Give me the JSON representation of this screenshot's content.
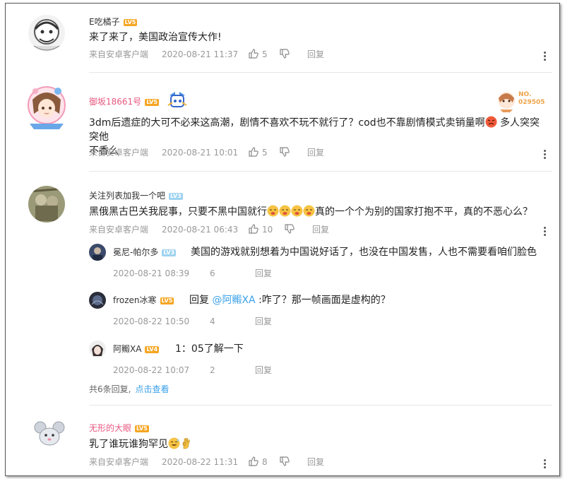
{
  "labels": {
    "source": "来自安卓客户端",
    "reply": "回复"
  },
  "colors": {
    "pink_name": "#e8587f",
    "level_orange": "#f5a623",
    "level_blue": "#9fd3f0",
    "link": "#3aa0e8",
    "meta": "#999999"
  },
  "comments": [
    {
      "user": "E吃橘子",
      "level": "LV5",
      "text": "来了来了，美国政治宣传大作!",
      "time": "2020-08-21 11:37",
      "likes": "5"
    },
    {
      "user": "御坂18661号",
      "level": "LV5",
      "text_part1": "3dm后遗症的大可不必来这高潮，剧情不喜欢不玩不就行了？cod也不靠剧情模式卖销量啊",
      "text_part2": "多人突突突他",
      "text_line2": "不香么",
      "time": "2020-08-21 10:01",
      "likes": "5",
      "badge_label": "NO.",
      "badge_number": "029505"
    },
    {
      "user": "关注列表加我一个吧",
      "level": "LV3",
      "text_part1": "黑俄黑古巴关我屁事，只要不黑中国就行",
      "text_part2": "真的一个个为别的国家打抱不平，真的不恶心么？",
      "time": "2020-08-21 06:43",
      "likes": "10"
    },
    {
      "user": "无形的大眼",
      "level": "LV5",
      "text": "乳了谁玩谁狗罕见",
      "time": "2020-08-22 11:31",
      "likes": "8"
    }
  ],
  "replies": [
    {
      "user": "冕尼-帕尔多",
      "level": "LV3",
      "text": "美国的游戏就别想着为中国说好话了，也没在中国发售，人也不需要看咱们脸色",
      "time": "2020-08-21 08:39",
      "likes": "6"
    },
    {
      "user": "frozen冰寒",
      "level": "LV5",
      "text_prefix": "回复",
      "mention": "@阿毈XA",
      "text": ":咋了？那一帧画面是虚构的？",
      "time": "2020-08-22 10:50",
      "likes": "4"
    },
    {
      "user": "阿毈XA",
      "level": "LV4",
      "text": "1：05了解一下",
      "time": "2020-08-22 10:07",
      "likes": "2"
    }
  ],
  "reply_summary": {
    "text": "共6条回复,",
    "link": "点击查看"
  }
}
